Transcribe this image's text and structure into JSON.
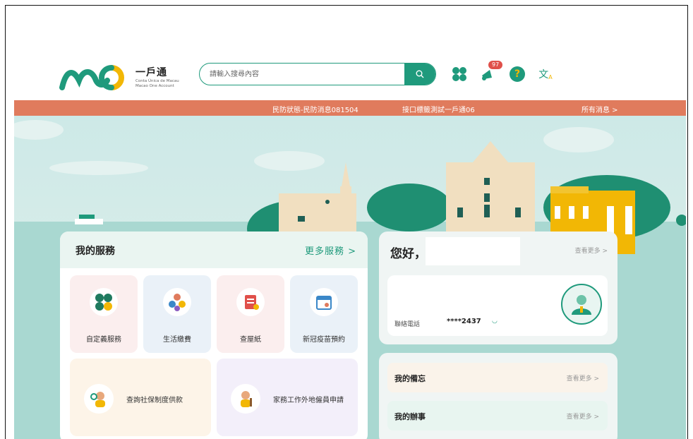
{
  "header": {
    "logo_title": "一戶通",
    "logo_sub1": "Conta Única de Macau",
    "logo_sub2": "Macao One Account",
    "search_placeholder": "請輸入搜尋內容",
    "notification_count": "97",
    "help_label": "?",
    "lang_label": "文"
  },
  "notice": {
    "item1": "民防狀態-民防消息081504",
    "item2": "接口標籤測試一戶通06",
    "all": "所有消息 >"
  },
  "services": {
    "title": "我的服務",
    "more": "更多服務 >",
    "tiles": [
      {
        "label": "自定義服務",
        "icon": "clover-icon"
      },
      {
        "label": "生活繳費",
        "icon": "utilities-icon"
      },
      {
        "label": "查屋紙",
        "icon": "property-document-icon"
      },
      {
        "label": "新冠疫苗預約",
        "icon": "calendar-icon"
      }
    ],
    "wide": [
      {
        "label": "查詢社保制度供款",
        "icon": "social-security-icon"
      },
      {
        "label": "家務工作外地僱員申請",
        "icon": "domestic-worker-icon"
      }
    ]
  },
  "greeting": {
    "hello": "您好，",
    "more": "查看更多 >",
    "phone_label": "聯絡電話",
    "phone_value": "****2437"
  },
  "todo": {
    "memo": "我的備忘",
    "memo_more": "查看更多 >",
    "tasks": "我的辦事",
    "tasks_more": "查看更多 >"
  },
  "colors": {
    "brand": "#1f9a7c",
    "notice": "#e07b5d",
    "logo_yellow": "#f2b705"
  }
}
